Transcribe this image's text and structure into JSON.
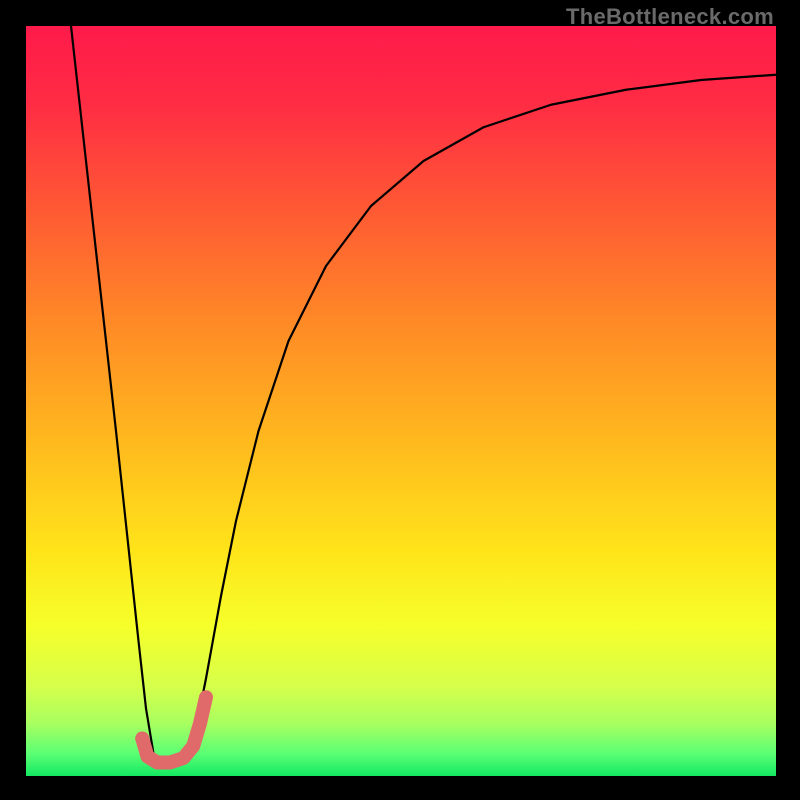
{
  "watermark": "TheBottleneck.com",
  "chart_data": {
    "type": "line",
    "title": "",
    "xlabel": "",
    "ylabel": "",
    "xlim": [
      0,
      100
    ],
    "ylim": [
      0,
      100
    ],
    "grid": false,
    "legend": false,
    "gradient_stops": [
      {
        "offset": 0.0,
        "color": "#ff1a4a"
      },
      {
        "offset": 0.1,
        "color": "#ff2b44"
      },
      {
        "offset": 0.25,
        "color": "#ff5b33"
      },
      {
        "offset": 0.4,
        "color": "#ff8b26"
      },
      {
        "offset": 0.55,
        "color": "#ffb81e"
      },
      {
        "offset": 0.7,
        "color": "#ffe41a"
      },
      {
        "offset": 0.8,
        "color": "#f6ff2a"
      },
      {
        "offset": 0.88,
        "color": "#d6ff4a"
      },
      {
        "offset": 0.93,
        "color": "#a8ff60"
      },
      {
        "offset": 0.97,
        "color": "#5bff74"
      },
      {
        "offset": 1.0,
        "color": "#14e862"
      }
    ],
    "series": [
      {
        "name": "left-branch",
        "color": "#000000",
        "width": 2.2,
        "x": [
          6,
          8,
          10,
          12,
          13.5,
          15,
          16,
          17
        ],
        "y": [
          100,
          82,
          64,
          46,
          32,
          18,
          9,
          3
        ]
      },
      {
        "name": "right-branch",
        "color": "#000000",
        "width": 2.2,
        "x": [
          22,
          24,
          26,
          28,
          31,
          35,
          40,
          46,
          53,
          61,
          70,
          80,
          90,
          100
        ],
        "y": [
          3,
          13,
          24,
          34,
          46,
          58,
          68,
          76,
          82,
          86.5,
          89.5,
          91.5,
          92.8,
          93.5
        ]
      },
      {
        "name": "j-accent",
        "color": "#e06a6a",
        "width": 14,
        "linecap": "round",
        "x": [
          15.5,
          16.2,
          17.5,
          19.2,
          21.0,
          22.3,
          23.2,
          24.0
        ],
        "y": [
          5.0,
          2.6,
          1.8,
          1.8,
          2.4,
          4.0,
          7.0,
          10.5
        ]
      }
    ],
    "marker": {
      "name": "j-dot",
      "x": 15.5,
      "y": 5.0,
      "r": 7,
      "color": "#e06a6a"
    }
  }
}
